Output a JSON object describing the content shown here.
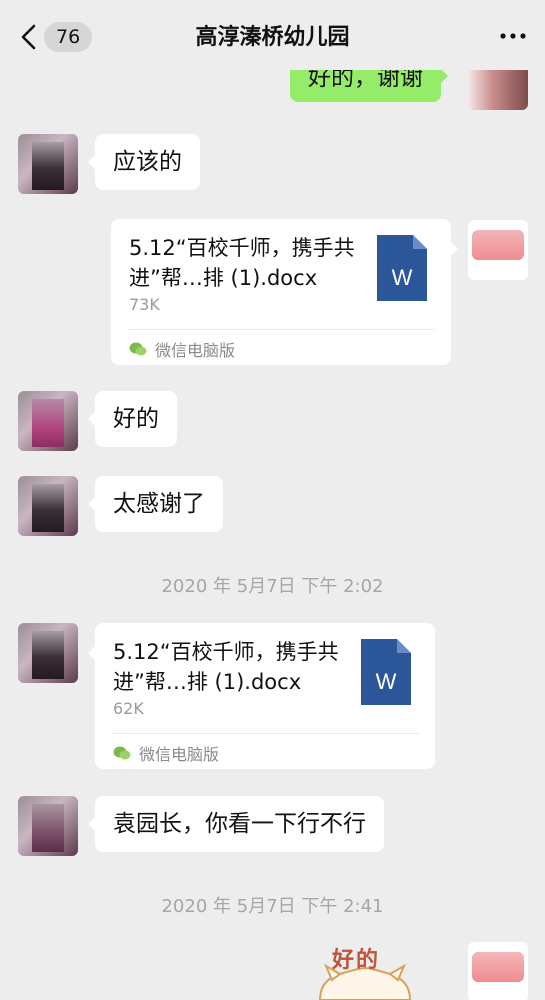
{
  "header": {
    "back_count": "76",
    "title": "高淳溱桥幼儿园"
  },
  "messages": {
    "m1": "好的，谢谢",
    "m2": "应该的",
    "m4": "好的",
    "m5": "太感谢了",
    "m7": "袁园长，你看一下行不行"
  },
  "files": {
    "f1": {
      "name": "5.12“百校千师，携手共进”帮…排 (1).docx",
      "size": "73K",
      "source": "微信电脑版",
      "icon": "word-doc-icon"
    },
    "f2": {
      "name": "5.12“百校千师，携手共进”帮…排 (1).docx",
      "size": "62K",
      "source": "微信电脑版",
      "icon": "word-doc-icon"
    }
  },
  "timestamps": {
    "t1": "2020 年 5月7日 下午 2:02",
    "t2": "2020 年 5月7日 下午 2:41"
  },
  "sticker": {
    "text": "好的"
  },
  "colors": {
    "background": "#ededed",
    "sent_bubble": "#95ec69",
    "received_bubble": "#ffffff",
    "word_blue": "#2b579a"
  }
}
